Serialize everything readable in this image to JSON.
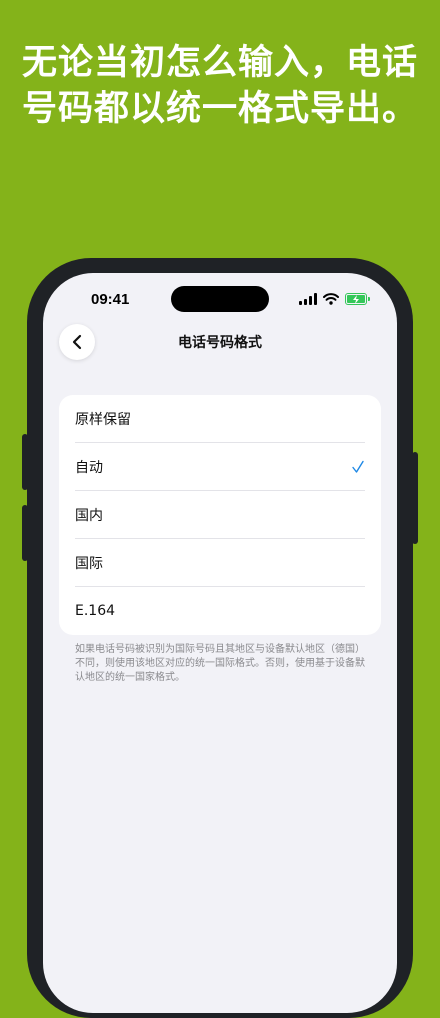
{
  "headline": "无论当初怎么输入，电话号码都以统一格式导出。",
  "status_bar": {
    "time": "09:41"
  },
  "navigation": {
    "title": "电话号码格式"
  },
  "options": [
    {
      "label": "原样保留",
      "selected": false
    },
    {
      "label": "自动",
      "selected": true
    },
    {
      "label": "国内",
      "selected": false
    },
    {
      "label": "国际",
      "selected": false
    },
    {
      "label": "E.164",
      "selected": false
    }
  ],
  "footnote": "如果电话号码被识别为国际号码且其地区与设备默认地区（德国）不同，则使用该地区对应的统一国际格式。否则，使用基于设备默认地区的统一国家格式。",
  "colors": {
    "background": "#84b31a",
    "accent": "#1e88e5",
    "phone_frame": "#1f2226",
    "battery": "#34c759"
  },
  "icons": {
    "back": "chevron-left-icon",
    "check": "checkmark-icon",
    "signal": "cellular-signal-icon",
    "wifi": "wifi-icon",
    "battery": "battery-charging-icon"
  }
}
